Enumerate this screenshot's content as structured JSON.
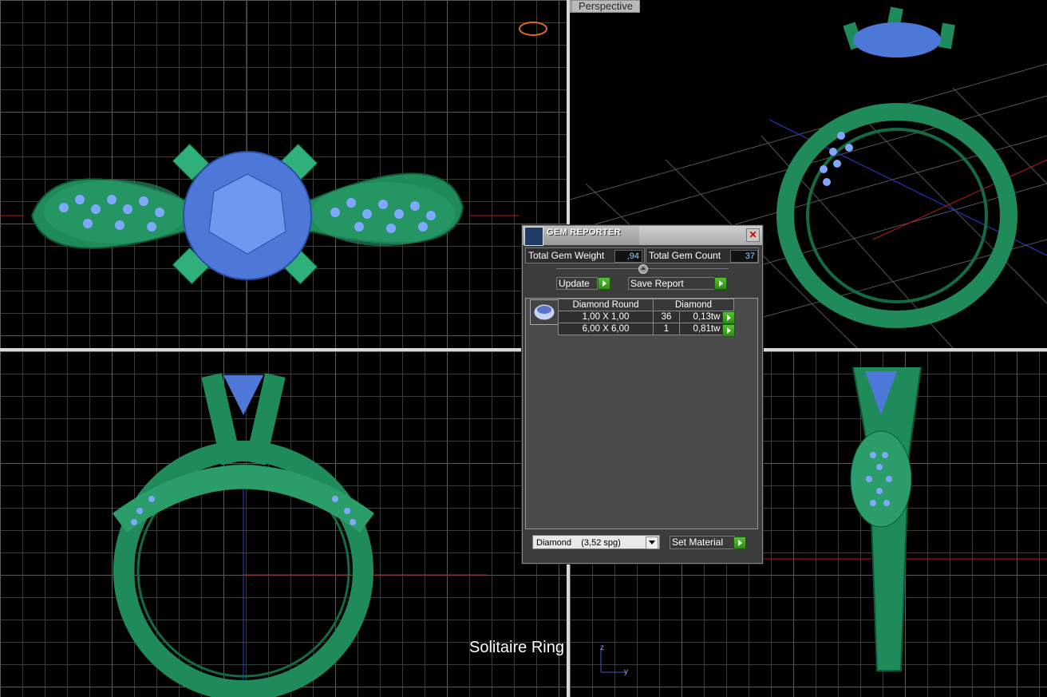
{
  "viewports": {
    "perspective_label": "Perspective"
  },
  "gem_reporter": {
    "title": "GEM REPORTER",
    "total_weight_label": "Total Gem Weight",
    "total_weight_value": ",94",
    "total_count_label": "Total Gem Count",
    "total_count_value": "37",
    "update_label": "Update",
    "save_report_label": "Save Report",
    "table_headers": [
      "Diamond Round",
      "Diamond"
    ],
    "rows": [
      {
        "size": "1,00 X 1,00",
        "count": "36",
        "weight": "0,13tw"
      },
      {
        "size": "6,00 X 6,00",
        "count": "1",
        "weight": "0,81tw"
      }
    ],
    "material_select": "Diamond    (3,52 spg)",
    "set_material_label": "Set Material"
  },
  "caption": "Solitaire Ring",
  "axis": {
    "z": "z",
    "y": "y"
  },
  "colors": {
    "metal": "#1f8a5a",
    "gem": "#5b86e0",
    "dialog_bg": "#3c3c3c"
  }
}
